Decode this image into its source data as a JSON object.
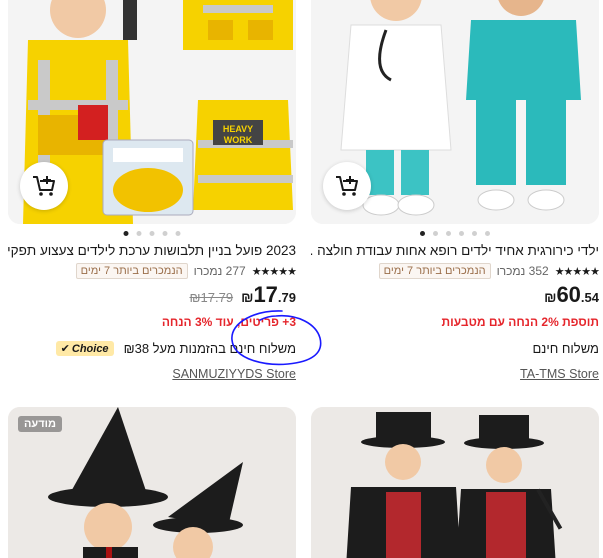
{
  "products": [
    {
      "title": "2023 פועל בניין תלבושות ערכת לילדים צעצוע תפקי...",
      "rating_count": "277 נמכרו",
      "best_seller": "הנמכרים ביותר",
      "best_rank": "7 ימים",
      "price_symbol": "₪",
      "price_whole": "17",
      "price_cents": ".79",
      "price_old": "₪17.79",
      "promo": "3+ פריטים, עוד 3% הנחה",
      "choice_label": "Choice",
      "shipping": "משלוח חינם בהזמנות מעל ₪38",
      "store": "SANMUZIYYDS Store"
    },
    {
      "title": "ילדי כירורגית אחיד ילדים רופא אחות עבודת חולצה ...",
      "rating_count": "352 נמכרו",
      "best_seller": "הנמכרים ביותר",
      "best_rank": "7 ימים",
      "price_symbol": "₪",
      "price_whole": "60",
      "price_cents": ".54",
      "promo": "תוספת 2% הנחה עם מטבעות",
      "shipping": "משלוח חינם",
      "store": "TA-TMS Store"
    }
  ],
  "ad_badge": "מודעה",
  "colors": {
    "accent": "#e5262c",
    "choice_bg": "#ffe9a6",
    "annotation": "#1a1aff"
  }
}
